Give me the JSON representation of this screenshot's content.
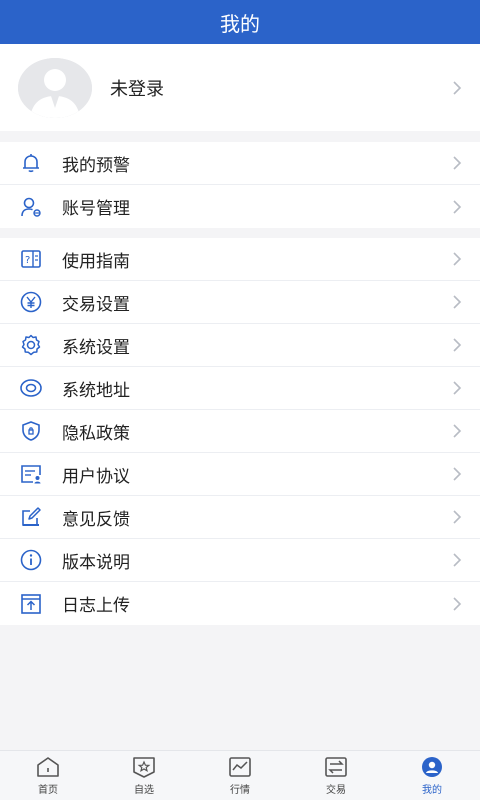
{
  "header": {
    "title": "我的"
  },
  "profile": {
    "name": "未登录"
  },
  "group1": [
    {
      "label": "我的预警",
      "icon": "bell-icon"
    },
    {
      "label": "账号管理",
      "icon": "account-icon"
    }
  ],
  "group2": [
    {
      "label": "使用指南",
      "icon": "guide-icon"
    },
    {
      "label": "交易设置",
      "icon": "yen-icon"
    },
    {
      "label": "系统设置",
      "icon": "gear-icon"
    },
    {
      "label": "系统地址",
      "icon": "eye-icon"
    },
    {
      "label": "隐私政策",
      "icon": "shield-icon"
    },
    {
      "label": "用户协议",
      "icon": "agreement-icon"
    },
    {
      "label": "意见反馈",
      "icon": "edit-icon"
    },
    {
      "label": "版本说明",
      "icon": "info-icon"
    },
    {
      "label": "日志上传",
      "icon": "upload-icon"
    }
  ],
  "tabs": [
    {
      "label": "首页",
      "icon": "home-icon"
    },
    {
      "label": "自选",
      "icon": "star-icon"
    },
    {
      "label": "行情",
      "icon": "chart-icon"
    },
    {
      "label": "交易",
      "icon": "trade-icon"
    },
    {
      "label": "我的",
      "icon": "user-icon",
      "active": true
    }
  ],
  "colors": {
    "accent": "#2b63c9"
  }
}
